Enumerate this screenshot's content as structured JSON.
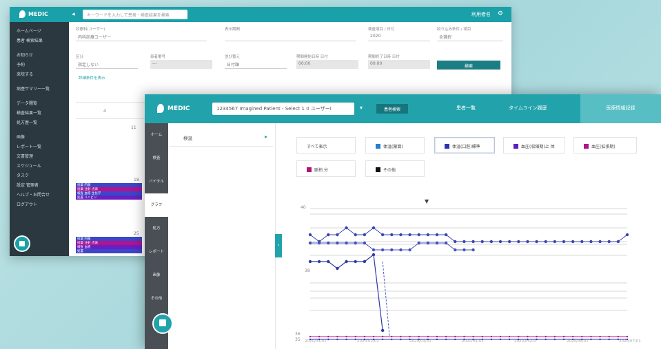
{
  "back_window": {
    "brand": "MEDIC",
    "search_placeholder": "キーワードを入力して患者・検査結果を検索",
    "user_menu": "利用者名",
    "sidebar": [
      "ホームページ",
      "患者 検索結果",
      "",
      "お知らせ",
      "予約",
      "来院する",
      "",
      "病歴サマリー一覧",
      "",
      "データ閲覧",
      "検査結果一覧",
      "処方歴一覧",
      "",
      "画像",
      "レポート一覧",
      "文書管理",
      "スケジュール",
      "タスク",
      "設定 管理者",
      "ヘルプ・お問合せ",
      "ログアウト"
    ],
    "form": {
      "fields": [
        {
          "label": "診療科(ユーザー)",
          "value": "内科診療ユーザー"
        },
        {
          "label": "表示期間",
          "value": ""
        },
        {
          "label": "検査項目 / 日付",
          "value": "2020"
        },
        {
          "label": "絞り込み条件 / 項目",
          "value": "全選択"
        },
        {
          "label": "区分",
          "value": "指定しない"
        },
        {
          "label": "患者番号",
          "value": "---"
        },
        {
          "label": "並び替え",
          "value": "日付順"
        },
        {
          "label": "期間開始日時 日付",
          "value": "00:00"
        },
        {
          "label": "期間終了日時 日付",
          "value": "00:00"
        }
      ],
      "search_button": "検索",
      "link": "詳細条件を表示"
    },
    "calendar": {
      "day": "4",
      "day2": "11",
      "day3": "18",
      "day4": "25"
    },
    "events": [
      {
        "label": "投薬 内服",
        "color": "#3a47c8"
      },
      {
        "label": "投薬 注射 点滴",
        "color": "#b0148f"
      },
      {
        "label": "検査 血液 生化学",
        "color": "#3a47c8"
      },
      {
        "label": "処置 リハビリ",
        "color": "#6a1fc4"
      },
      {
        "label": "投薬 内服",
        "color": "#3a47c8"
      },
      {
        "label": "投薬 注射 点滴",
        "color": "#b0148f"
      },
      {
        "label": "検査 血液",
        "color": "#6a1fc4"
      },
      {
        "label": "処置",
        "color": "#3a47c8"
      }
    ]
  },
  "front_window": {
    "brand": "MEDIC",
    "patient_select": "1234567 Imagined Patient - Select 1 0 ユーザーI",
    "select_button": "患者検索",
    "nav": [
      "患者一覧",
      "タイムライン履歴",
      "医療情報記録"
    ],
    "sidebar": [
      "ホーム",
      "検査",
      "バイタル",
      "グラフ",
      "処方",
      "レポート",
      "画像",
      "その他"
    ],
    "list_item": "検温",
    "legend": [
      {
        "label": "すべて表示",
        "color": ""
      },
      {
        "label": "体温(腋窩)",
        "color": "#2b7cc9"
      },
      {
        "label": "体温(口腔)標準",
        "color": "#2a33b5"
      },
      {
        "label": "血圧(収縮期)上 体",
        "color": "#5d1fba"
      },
      {
        "label": "血圧(拡張期)",
        "color": "#b0148f"
      },
      {
        "label": "脈拍 分",
        "color": "#b0147a"
      },
      {
        "label": "その他",
        "color": "#111111"
      }
    ],
    "chart_header_marker": "▼"
  },
  "chart_data": {
    "type": "line",
    "y_labels": [
      "40",
      "38",
      "36",
      "35"
    ],
    "x_labels": [
      "2020/01/01",
      "2020/02/01",
      "2020/03/01",
      "2020/04/01",
      "2020/05/01",
      "2020/06/01",
      "2020/07/01"
    ],
    "series": [
      {
        "color": "#3a45b0",
        "values": [
          38.0,
          37.8,
          38.0,
          38.0,
          38.2,
          38.0,
          38.0,
          38.2,
          38.0,
          38.0,
          38.0,
          38.0,
          38.0,
          38.0,
          38.0,
          38.0,
          37.8,
          37.8,
          37.8,
          37.8,
          37.8,
          37.8,
          37.8,
          37.8,
          37.8,
          37.8,
          37.8,
          37.8,
          37.8,
          37.8,
          37.8,
          37.8,
          37.8,
          37.8,
          37.8,
          38.0
        ]
      },
      {
        "color": "#4450c0",
        "values": [
          37.8,
          37.8,
          37.8,
          37.8,
          37.8,
          37.8,
          37.8,
          37.6,
          37.6,
          37.6,
          37.6,
          37.6,
          37.8,
          37.8,
          37.8,
          37.8,
          37.6,
          37.6,
          37.6
        ]
      },
      {
        "color": "#2e3aa0",
        "values": [
          37.2,
          37.2,
          37.2,
          37.0,
          37.2,
          37.2,
          37.2,
          37.4,
          35.2
        ]
      },
      {
        "color": "#b0148f",
        "values": [
          35.0,
          35.0,
          35.0,
          35.0,
          35.0,
          35.0,
          35.0,
          35.0,
          35.0,
          35.0,
          35.0,
          35.0,
          35.0,
          35.0,
          35.0,
          35.0,
          35.0,
          35.0,
          35.0,
          35.0,
          35.0,
          35.0,
          35.0,
          35.0,
          35.0,
          35.0,
          35.0,
          35.0,
          35.0,
          35.0,
          35.0,
          35.0,
          35.0,
          35.0,
          35.0,
          35.0
        ]
      },
      {
        "color": "#2a33b5",
        "values": [
          34.9,
          34.9,
          34.9,
          34.9,
          34.9,
          34.9,
          34.9,
          34.9,
          34.9,
          34.9,
          34.9,
          34.9,
          34.9,
          34.9,
          34.9,
          34.9,
          34.9,
          34.9,
          34.9,
          34.9,
          34.9,
          34.9,
          34.9,
          34.9,
          34.9,
          34.9,
          34.9,
          34.9,
          34.9,
          34.9,
          34.9,
          34.9,
          34.9,
          34.9,
          34.9,
          34.9
        ]
      }
    ]
  }
}
